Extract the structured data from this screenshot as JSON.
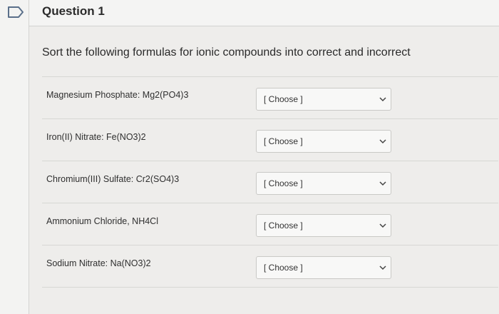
{
  "header": {
    "title": "Question 1"
  },
  "question": {
    "prompt": "Sort the following formulas for ionic compounds into correct and incorrect",
    "rows": [
      {
        "label": "Magnesium Phosphate: Mg2(PO4)3",
        "selected": "[ Choose ]"
      },
      {
        "label": "Iron(II) Nitrate: Fe(NO3)2",
        "selected": "[ Choose ]"
      },
      {
        "label": "Chromium(III) Sulfate: Cr2(SO4)3",
        "selected": "[ Choose ]"
      },
      {
        "label": "Ammonium Chloride, NH4Cl",
        "selected": "[ Choose ]"
      },
      {
        "label": "Sodium Nitrate: Na(NO3)2",
        "selected": "[ Choose ]"
      }
    ]
  },
  "colors": {
    "flag_outline": "#5a6f8a",
    "background": "#eeedeb"
  },
  "icons": {
    "flag": "flag-icon",
    "dropdown": "chevron-down-icon"
  }
}
